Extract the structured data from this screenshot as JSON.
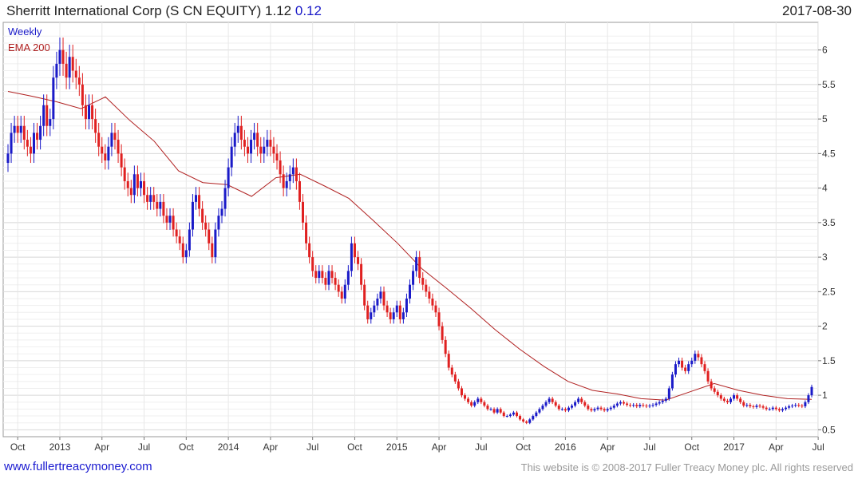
{
  "header": {
    "title": "Sherritt International Corp (S CN EQUITY) 1.12",
    "change": "0.12",
    "date": "2017-08-30"
  },
  "footer": {
    "left_link": "www.fullertreacymoney.com",
    "right_text": "This website is © 2008-2017 Fuller Treacy Money plc. All rights reserved"
  },
  "chart_data": {
    "type": "candlestick",
    "title": "Sherritt International Corp (S CN EQUITY) 1.12 0.12",
    "legend": [
      "Weekly",
      "EMA 200"
    ],
    "legend_placement": "top-left",
    "colors": {
      "up": "#1a1ac8",
      "down": "#e02020",
      "ema": "#b02020",
      "grid": "#e3e3e3",
      "legend_weekly": "#1a1ac8",
      "legend_ema": "#b02020"
    },
    "x_labels": [
      "Oct",
      "2013",
      "Apr",
      "Jul",
      "Oct",
      "2014",
      "Apr",
      "Jul",
      "Oct",
      "2015",
      "Apr",
      "Jul",
      "Oct",
      "2016",
      "Apr",
      "Jul",
      "Oct",
      "2017",
      "Apr",
      "Jul"
    ],
    "y_ticks": [
      "0.5",
      "1",
      "1.5",
      "2",
      "2.5",
      "3",
      "3.5",
      "4",
      "4.5",
      "5",
      "5.5",
      "6"
    ],
    "ylim": [
      0.4,
      6.4
    ],
    "grid": true,
    "weeks": 265,
    "close": [
      4.5,
      4.8,
      4.9,
      4.8,
      4.9,
      4.7,
      4.6,
      4.5,
      4.8,
      4.7,
      4.9,
      5.2,
      4.9,
      5.0,
      5.6,
      5.8,
      6.0,
      5.8,
      5.6,
      5.9,
      5.7,
      5.6,
      5.5,
      5.2,
      5.0,
      5.2,
      5.0,
      4.8,
      4.6,
      4.5,
      4.4,
      4.6,
      4.8,
      4.7,
      4.5,
      4.3,
      4.1,
      4.0,
      3.9,
      4.2,
      4.0,
      4.1,
      3.9,
      3.8,
      3.9,
      3.8,
      3.7,
      3.8,
      3.6,
      3.5,
      3.6,
      3.4,
      3.3,
      3.2,
      3.0,
      3.1,
      3.4,
      3.8,
      3.9,
      3.7,
      3.5,
      3.4,
      3.2,
      3.0,
      3.4,
      3.6,
      3.7,
      4.0,
      4.3,
      4.6,
      4.8,
      4.9,
      4.7,
      4.6,
      4.5,
      4.7,
      4.8,
      4.6,
      4.5,
      4.6,
      4.7,
      4.6,
      4.5,
      4.4,
      4.2,
      4.0,
      4.1,
      4.2,
      4.3,
      4.1,
      3.8,
      3.5,
      3.2,
      3.0,
      2.8,
      2.7,
      2.8,
      2.7,
      2.6,
      2.8,
      2.7,
      2.6,
      2.5,
      2.4,
      2.6,
      2.8,
      3.2,
      3.0,
      2.9,
      2.6,
      2.3,
      2.1,
      2.2,
      2.3,
      2.4,
      2.5,
      2.3,
      2.2,
      2.1,
      2.2,
      2.3,
      2.1,
      2.2,
      2.4,
      2.6,
      2.8,
      3.0,
      2.7,
      2.6,
      2.5,
      2.4,
      2.3,
      2.2,
      2.0,
      1.8,
      1.6,
      1.4,
      1.3,
      1.2,
      1.1,
      1.0,
      0.95,
      0.9,
      0.85,
      0.9,
      0.95,
      0.9,
      0.85,
      0.8,
      0.8,
      0.75,
      0.8,
      0.75,
      0.7,
      0.7,
      0.72,
      0.75,
      0.7,
      0.65,
      0.62,
      0.6,
      0.65,
      0.7,
      0.75,
      0.8,
      0.85,
      0.9,
      0.95,
      0.9,
      0.85,
      0.8,
      0.8,
      0.78,
      0.82,
      0.85,
      0.9,
      0.95,
      0.9,
      0.85,
      0.8,
      0.78,
      0.8,
      0.82,
      0.8,
      0.78,
      0.8,
      0.82,
      0.85,
      0.88,
      0.9,
      0.88,
      0.86,
      0.85,
      0.86,
      0.84,
      0.86,
      0.85,
      0.84,
      0.85,
      0.86,
      0.88,
      0.9,
      0.92,
      0.95,
      1.1,
      1.3,
      1.45,
      1.5,
      1.4,
      1.35,
      1.45,
      1.5,
      1.6,
      1.55,
      1.45,
      1.35,
      1.2,
      1.1,
      1.05,
      1.0,
      0.95,
      0.92,
      0.9,
      0.95,
      1.0,
      0.95,
      0.9,
      0.85,
      0.86,
      0.84,
      0.83,
      0.85,
      0.84,
      0.82,
      0.8,
      0.8,
      0.82,
      0.8,
      0.78,
      0.8,
      0.82,
      0.84,
      0.85,
      0.86,
      0.85,
      0.84,
      0.9,
      1.0,
      1.12
    ],
    "ema200": [
      5.4,
      5.33,
      5.25,
      5.15,
      5.32,
      4.98,
      4.68,
      4.25,
      4.08,
      4.05,
      3.88,
      4.15,
      4.2,
      4.03,
      3.85,
      3.53,
      3.2,
      2.83,
      2.55,
      2.26,
      1.95,
      1.67,
      1.42,
      1.2,
      1.07,
      1.02,
      0.95,
      0.93,
      1.05,
      1.17,
      1.07,
      1.0,
      0.95,
      0.94
    ]
  }
}
